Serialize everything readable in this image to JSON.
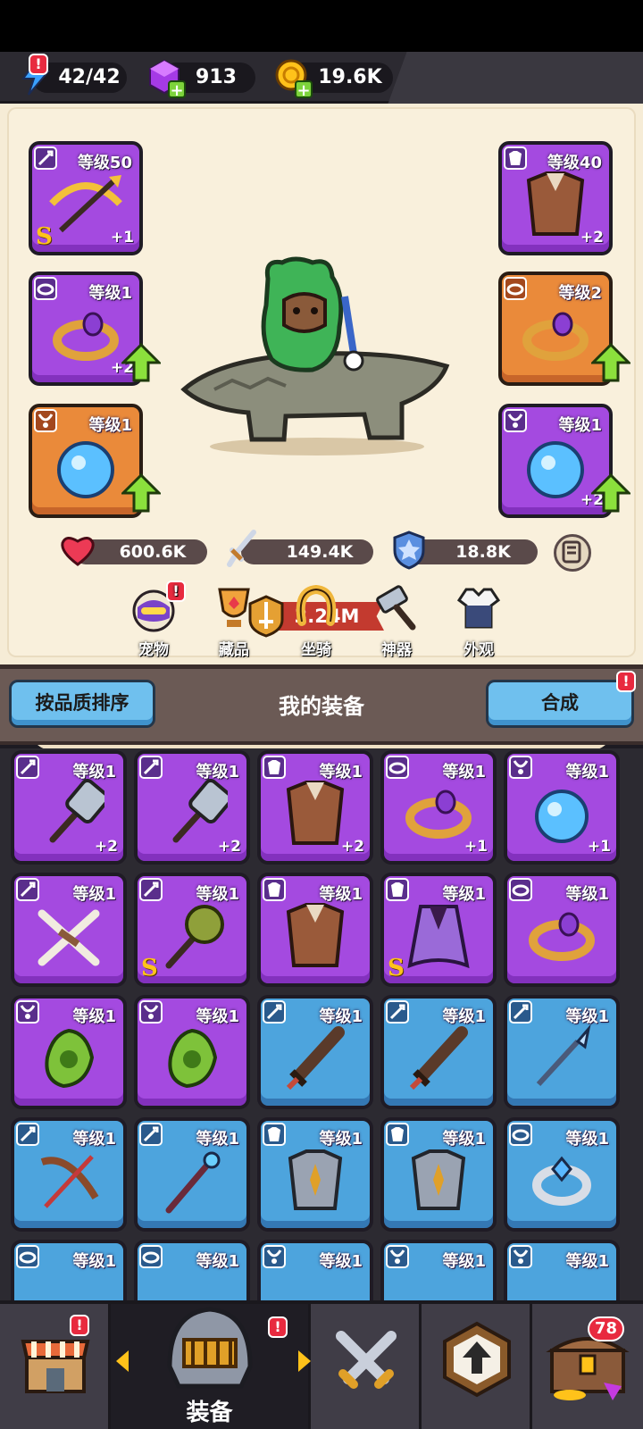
{
  "resources": {
    "energy": "42/42",
    "gems": "913",
    "gold": "19.6K"
  },
  "hero": {
    "left_slots": [
      {
        "level": "等级50",
        "plus": "+1",
        "rank": "S",
        "type": "weapon"
      },
      {
        "level": "等级1",
        "plus": "+2",
        "type": "ring"
      },
      {
        "level": "等级1",
        "plus": "",
        "type": "necklace"
      }
    ],
    "right_slots": [
      {
        "level": "等级40",
        "plus": "+2",
        "type": "armor"
      },
      {
        "level": "等级2",
        "plus": "",
        "type": "ring"
      },
      {
        "level": "等级1",
        "plus": "+2",
        "type": "necklace"
      }
    ],
    "power": "3.24M",
    "hp": "600.6K",
    "attack": "149.4K",
    "defense": "18.8K"
  },
  "nav": [
    "宠物",
    "藏品",
    "坐骑",
    "神器",
    "外观"
  ],
  "equipment": {
    "sort_button": "按品质排序",
    "title": "我的装备",
    "merge_button": "合成",
    "items": [
      {
        "level": "等级1",
        "plus": "+2",
        "rank": "",
        "color": "purple",
        "type": "weapon",
        "art": "hammer"
      },
      {
        "level": "等级1",
        "plus": "+2",
        "rank": "",
        "color": "purple",
        "type": "weapon",
        "art": "hammer"
      },
      {
        "level": "等级1",
        "plus": "+2",
        "rank": "",
        "color": "purple",
        "type": "armor",
        "art": "fur"
      },
      {
        "level": "等级1",
        "plus": "+1",
        "rank": "",
        "color": "purple",
        "type": "ring",
        "art": "ring"
      },
      {
        "level": "等级1",
        "plus": "+1",
        "rank": "",
        "color": "purple",
        "type": "necklace",
        "art": "orb"
      },
      {
        "level": "等级1",
        "plus": "",
        "rank": "",
        "color": "purple",
        "type": "weapon",
        "art": "bones"
      },
      {
        "level": "等级1",
        "plus": "",
        "rank": "S",
        "color": "purple",
        "type": "weapon",
        "art": "mace"
      },
      {
        "level": "等级1",
        "plus": "",
        "rank": "",
        "color": "purple",
        "type": "armor",
        "art": "fur"
      },
      {
        "level": "等级1",
        "plus": "",
        "rank": "S",
        "color": "purple",
        "type": "armor",
        "art": "cape"
      },
      {
        "level": "等级1",
        "plus": "",
        "rank": "",
        "color": "purple",
        "type": "ring",
        "art": "ring"
      },
      {
        "level": "等级1",
        "plus": "",
        "rank": "",
        "color": "purple",
        "type": "necklace",
        "art": "gem"
      },
      {
        "level": "等级1",
        "plus": "",
        "rank": "",
        "color": "purple",
        "type": "necklace",
        "art": "gem"
      },
      {
        "level": "等级1",
        "plus": "",
        "rank": "",
        "color": "blue",
        "type": "weapon",
        "art": "sword"
      },
      {
        "level": "等级1",
        "plus": "",
        "rank": "",
        "color": "blue",
        "type": "weapon",
        "art": "sword"
      },
      {
        "level": "等级1",
        "plus": "",
        "rank": "",
        "color": "blue",
        "type": "weapon",
        "art": "staff"
      },
      {
        "level": "等级1",
        "plus": "",
        "rank": "",
        "color": "blue",
        "type": "weapon",
        "art": "bow"
      },
      {
        "level": "等级1",
        "plus": "",
        "rank": "",
        "color": "blue",
        "type": "weapon",
        "art": "wand"
      },
      {
        "level": "等级1",
        "plus": "",
        "rank": "",
        "color": "blue",
        "type": "armor",
        "art": "plate"
      },
      {
        "level": "等级1",
        "plus": "",
        "rank": "",
        "color": "blue",
        "type": "armor",
        "art": "plate"
      },
      {
        "level": "等级1",
        "plus": "",
        "rank": "",
        "color": "blue",
        "type": "ring",
        "art": "silver-ring"
      },
      {
        "level": "等级1",
        "plus": "",
        "rank": "",
        "color": "blue",
        "type": "ring",
        "art": ""
      },
      {
        "level": "等级1",
        "plus": "",
        "rank": "",
        "color": "blue",
        "type": "ring",
        "art": ""
      },
      {
        "level": "等级1",
        "plus": "",
        "rank": "",
        "color": "blue",
        "type": "necklace",
        "art": ""
      },
      {
        "level": "等级1",
        "plus": "",
        "rank": "",
        "color": "blue",
        "type": "necklace",
        "art": ""
      },
      {
        "level": "等级1",
        "plus": "",
        "rank": "",
        "color": "blue",
        "type": "necklace",
        "art": ""
      }
    ]
  },
  "bottom_tabs": [
    {
      "label": "",
      "icon": "shop-icon",
      "badge": "!"
    },
    {
      "label": "装备",
      "icon": "helmet-icon",
      "badge": "!"
    },
    {
      "label": "",
      "icon": "crossed-swords-icon"
    },
    {
      "label": "",
      "icon": "upgrade-icon"
    },
    {
      "label": "",
      "icon": "treasure-chest-icon",
      "count": "78"
    }
  ]
}
